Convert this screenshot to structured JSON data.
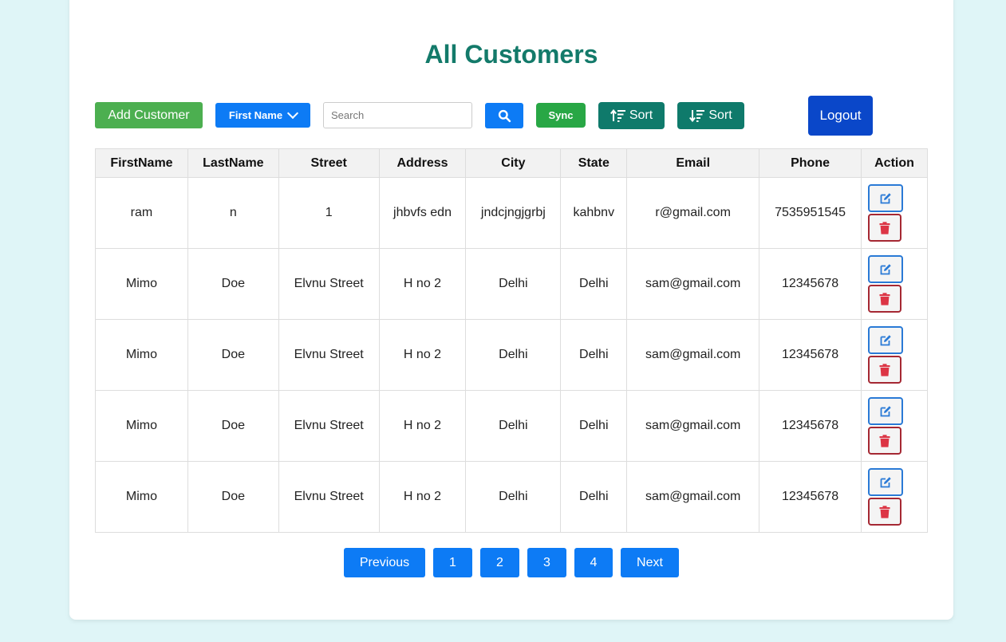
{
  "page": {
    "title": "All Customers"
  },
  "toolbar": {
    "add_label": "Add Customer",
    "filter_selected": "First Name",
    "search_placeholder": "Search",
    "sync_label": "Sync",
    "sort_asc_label": "Sort",
    "sort_desc_label": "Sort",
    "logout_label": "Logout"
  },
  "table": {
    "headers": [
      "FirstName",
      "LastName",
      "Street",
      "Address",
      "City",
      "State",
      "Email",
      "Phone",
      "Action"
    ],
    "rows": [
      [
        "ram",
        "n",
        "1",
        "jhbvfs edn",
        "jndcjngjgrbj",
        "kahbnv",
        "r@gmail.com",
        "7535951545"
      ],
      [
        "Mimo",
        "Doe",
        "Elvnu Street",
        "H no 2",
        "Delhi",
        "Delhi",
        "sam@gmail.com",
        "12345678"
      ],
      [
        "Mimo",
        "Doe",
        "Elvnu Street",
        "H no 2",
        "Delhi",
        "Delhi",
        "sam@gmail.com",
        "12345678"
      ],
      [
        "Mimo",
        "Doe",
        "Elvnu Street",
        "H no 2",
        "Delhi",
        "Delhi",
        "sam@gmail.com",
        "12345678"
      ],
      [
        "Mimo",
        "Doe",
        "Elvnu Street",
        "H no 2",
        "Delhi",
        "Delhi",
        "sam@gmail.com",
        "12345678"
      ]
    ]
  },
  "pagination": {
    "previous_label": "Previous",
    "pages": [
      "1",
      "2",
      "3",
      "4"
    ],
    "next_label": "Next"
  },
  "colors": {
    "title": "#137a6a",
    "primary": "#0d7bf5",
    "add": "#4caf50",
    "sync": "#28a745",
    "sort": "#0f7a6b",
    "logout": "#0a47c9",
    "edit": "#2a7ad6",
    "delete": "#dc3545"
  },
  "icons": {
    "filter_dropdown": "chevron-down-icon",
    "search_button": "search-icon",
    "sort_asc": "sort-amount-up-icon",
    "sort_desc": "sort-amount-down-icon",
    "edit": "edit-icon",
    "delete": "trash-icon"
  }
}
